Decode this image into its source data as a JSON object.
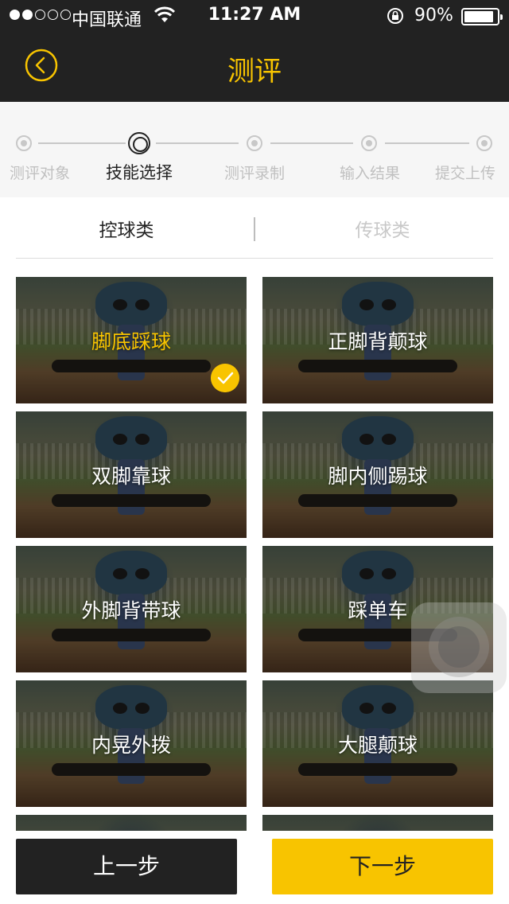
{
  "status_bar": {
    "carrier": "中国联通",
    "time": "11:27 AM",
    "battery_percent": "90%",
    "signal_bars_filled": 2,
    "signal_bars_total": 5,
    "battery_level": 0.9
  },
  "nav": {
    "title": "测评",
    "back_icon": "chevron-left-circle-icon"
  },
  "steps": {
    "items": [
      {
        "label": "测评对象",
        "state": "done"
      },
      {
        "label": "技能选择",
        "state": "current"
      },
      {
        "label": "测评录制",
        "state": "todo"
      },
      {
        "label": "输入结果",
        "state": "todo"
      },
      {
        "label": "提交上传",
        "state": "todo"
      }
    ]
  },
  "tabs": [
    {
      "label": "控球类",
      "active": true
    },
    {
      "label": "传球类",
      "active": false
    }
  ],
  "skills": [
    {
      "label": "脚底踩球",
      "selected": true
    },
    {
      "label": "正脚背颠球",
      "selected": false
    },
    {
      "label": "双脚靠球",
      "selected": false
    },
    {
      "label": "脚内侧踢球",
      "selected": false
    },
    {
      "label": "外脚背带球",
      "selected": false
    },
    {
      "label": "踩单车",
      "selected": false
    },
    {
      "label": "内晃外拨",
      "selected": false
    },
    {
      "label": "大腿颠球",
      "selected": false
    }
  ],
  "footer": {
    "prev_label": "上一步",
    "next_label": "下一步"
  },
  "colors": {
    "accent": "#f8c400",
    "dark": "#222222",
    "inactive": "#c8c8c8"
  }
}
